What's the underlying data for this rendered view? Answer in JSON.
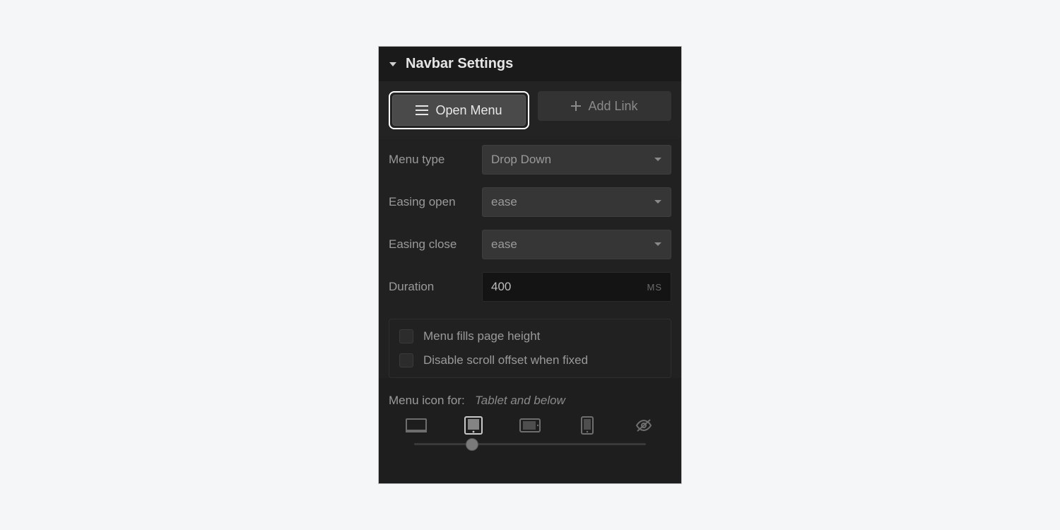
{
  "header": {
    "title": "Navbar Settings"
  },
  "buttons": {
    "open_menu": "Open Menu",
    "add_link": "Add Link"
  },
  "fields": {
    "menu_type": {
      "label": "Menu type",
      "value": "Drop Down"
    },
    "easing_open": {
      "label": "Easing open",
      "value": "ease"
    },
    "easing_close": {
      "label": "Easing close",
      "value": "ease"
    },
    "duration": {
      "label": "Duration",
      "value": "400",
      "unit": "MS"
    }
  },
  "checkboxes": {
    "fills_height": "Menu fills page height",
    "disable_scroll": "Disable scroll offset when fixed"
  },
  "menu_icon": {
    "label": "Menu icon for:",
    "value": "Tablet and below"
  }
}
